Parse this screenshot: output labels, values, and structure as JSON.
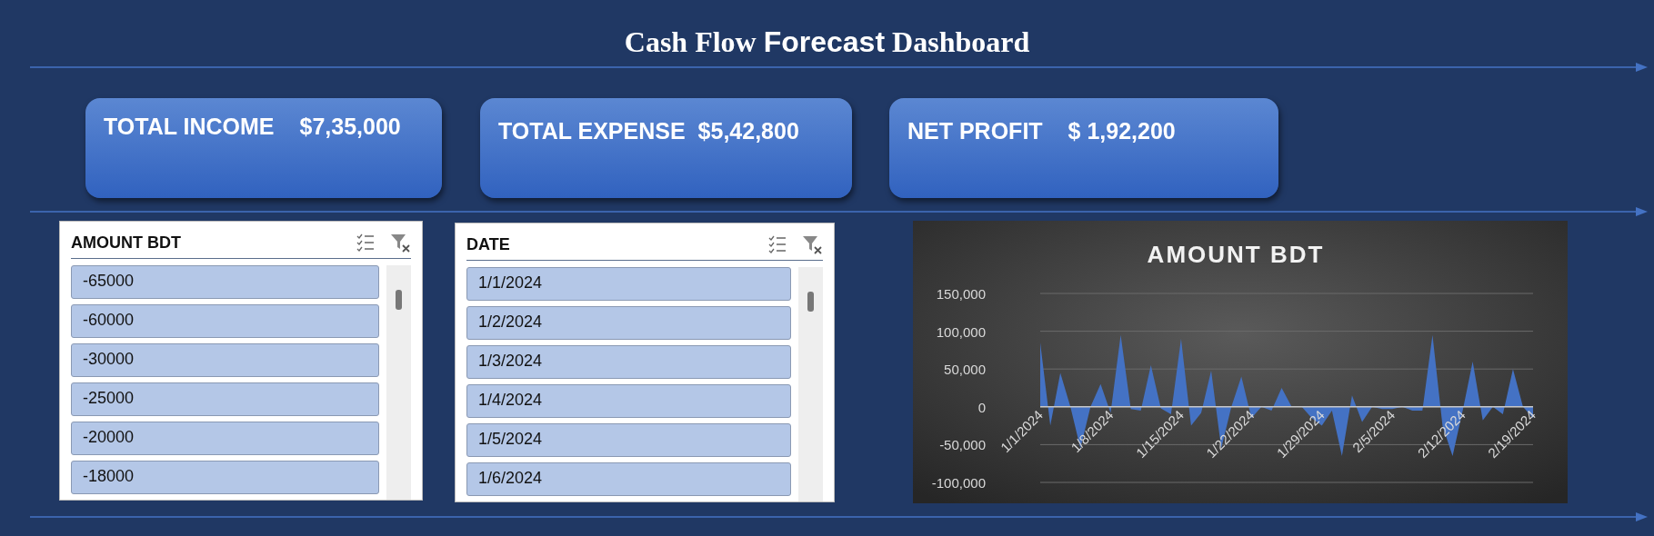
{
  "title": "Cash Flow **Forecast** Dashboard",
  "cards": [
    {
      "label": "TOTAL INCOME",
      "value": "$7,35,000"
    },
    {
      "label": "TOTAL EXPENSE",
      "value": "$5,42,800"
    },
    {
      "label": "NET PROFIT",
      "value": "$ 1,92,200"
    }
  ],
  "slicers": [
    {
      "title": "AMOUNT BDT",
      "items": [
        "-65000",
        "-60000",
        "-30000",
        "-25000",
        "-20000",
        "-18000"
      ]
    },
    {
      "title": "DATE",
      "items": [
        "1/1/2024",
        "1/2/2024",
        "1/3/2024",
        "1/4/2024",
        "1/5/2024",
        "1/6/2024"
      ]
    }
  ],
  "chart": {
    "chart_data": {
      "type": "area",
      "title": "AMOUNT BDT",
      "grid": true,
      "ylim": [
        -100000,
        150000
      ],
      "yticks": [
        {
          "value": -100000,
          "label": "-100,000"
        },
        {
          "value": -50000,
          "label": "-50,000"
        },
        {
          "value": 0,
          "label": "0"
        },
        {
          "value": 50000,
          "label": "50,000"
        },
        {
          "value": 100000,
          "label": "100,000"
        },
        {
          "value": 150000,
          "label": "150,000"
        }
      ],
      "categories": [
        "1/1/2024",
        null,
        null,
        null,
        null,
        null,
        null,
        "1/8/2024",
        null,
        null,
        null,
        null,
        null,
        null,
        "1/15/2024",
        null,
        null,
        null,
        null,
        null,
        null,
        "1/22/2024",
        null,
        null,
        null,
        null,
        null,
        null,
        "1/29/2024",
        null,
        null,
        null,
        null,
        null,
        null,
        "2/5/2024",
        null,
        null,
        null,
        null,
        null,
        null,
        "2/12/2024",
        null,
        null,
        null,
        null,
        null,
        null,
        "2/19/2024"
      ],
      "values": [
        85000,
        -25000,
        45000,
        0,
        -55000,
        0,
        30000,
        -8000,
        95000,
        -3000,
        -5000,
        55000,
        -2000,
        -10000,
        90000,
        -25000,
        -8000,
        48000,
        -55000,
        0,
        40000,
        -15000,
        0,
        -5000,
        25000,
        0,
        0,
        -15000,
        -25000,
        -5000,
        -65000,
        15000,
        -20000,
        0,
        -3000,
        -3000,
        0,
        -5000,
        -5000,
        95000,
        -25000,
        -65000,
        -5000,
        60000,
        -18000,
        0,
        -10000,
        50000,
        0,
        -15000
      ]
    }
  }
}
